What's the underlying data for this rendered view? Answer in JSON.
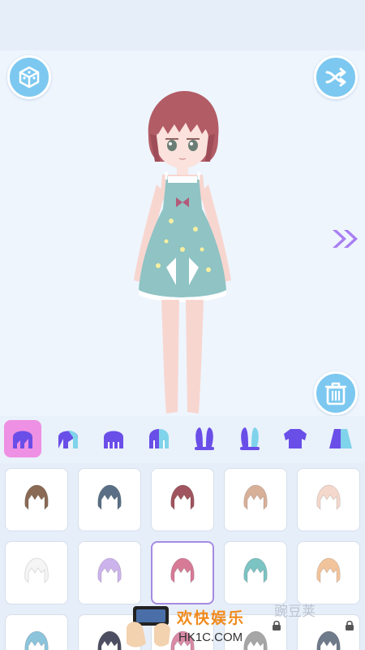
{
  "colors": {
    "accent_blue": "#7cc8f0",
    "tab_icon_purple": "#6a4ee8",
    "active_tab_pink": "#ee90e3",
    "selected_border": "#a58be0",
    "background": "#eef3fa"
  },
  "toolbar": {
    "left_button_icon": "cube-icon",
    "right_button_icon": "shuffle-icon",
    "next_icon": "double-chevron-right-icon",
    "delete_icon": "trash-icon"
  },
  "category_tabs": [
    {
      "icon": "hair-front-icon",
      "active": true
    },
    {
      "icon": "hair-side-icon",
      "active": false
    },
    {
      "icon": "hair-back-icon",
      "active": false
    },
    {
      "icon": "hair-half-icon",
      "active": false
    },
    {
      "icon": "bunny-ears-icon",
      "active": false
    },
    {
      "icon": "ears-half-icon",
      "active": false
    },
    {
      "icon": "top-icon",
      "active": false
    },
    {
      "icon": "outfit-half-icon",
      "active": false
    }
  ],
  "hair_items": [
    {
      "color": "#8a6a55",
      "selected": false,
      "locked": false
    },
    {
      "color": "#5a6f85",
      "selected": false,
      "locked": false
    },
    {
      "color": "#a0545e",
      "selected": false,
      "locked": false
    },
    {
      "color": "#d8b098",
      "selected": false,
      "locked": false
    },
    {
      "color": "#f4d8cc",
      "selected": false,
      "locked": false
    },
    {
      "color": "#f5f5f5",
      "selected": false,
      "locked": false
    },
    {
      "color": "#cdb3ec",
      "selected": false,
      "locked": false
    },
    {
      "color": "#d67a96",
      "selected": true,
      "locked": false
    },
    {
      "color": "#7cc3c3",
      "selected": false,
      "locked": false
    },
    {
      "color": "#f2c49c",
      "selected": false,
      "locked": false
    },
    {
      "color": "#8cc4dc",
      "selected": false,
      "locked": false
    },
    {
      "color": "#4e4e62",
      "selected": false,
      "locked": false
    },
    {
      "color": "#d98aa6",
      "selected": false,
      "locked": false
    },
    {
      "color": "#a6a6a6",
      "selected": false,
      "locked": true
    },
    {
      "color": "#6f7a8a",
      "selected": false,
      "locked": true
    }
  ],
  "watermark": {
    "title": "欢快娱乐",
    "url": "HK1C.COM",
    "faint_text": "豌豆荚"
  }
}
